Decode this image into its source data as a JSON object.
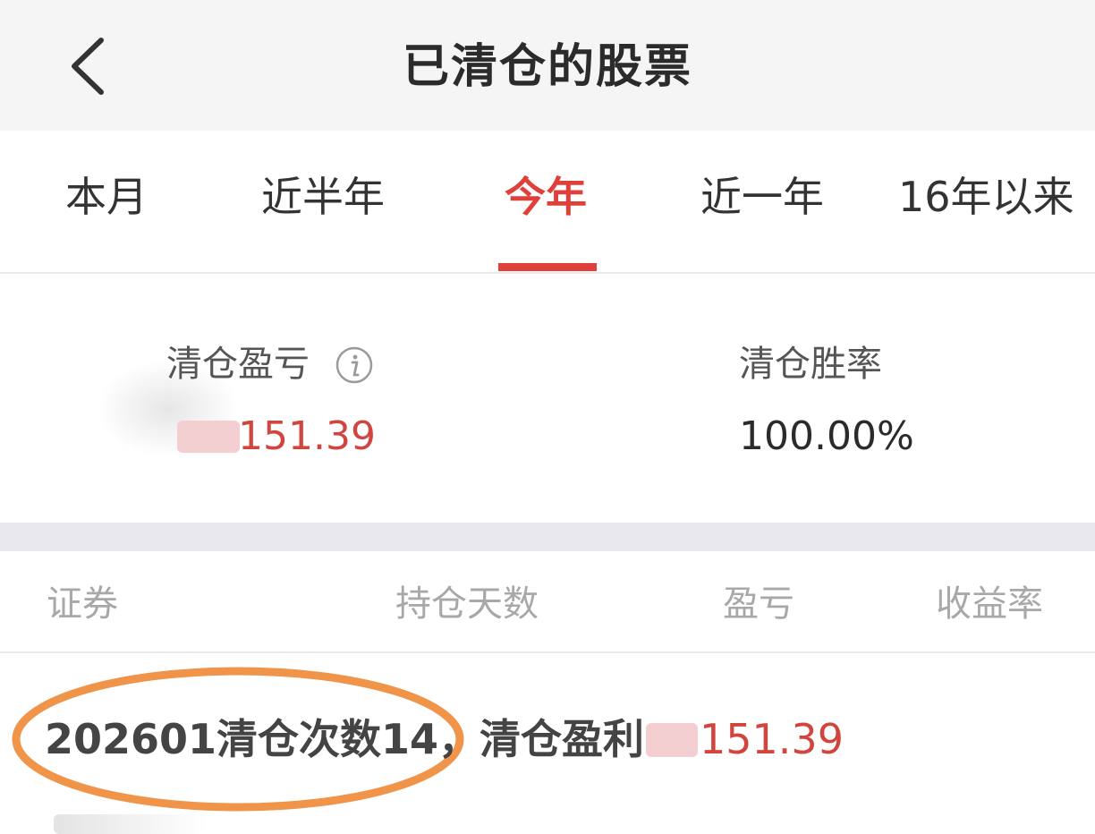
{
  "header": {
    "title": "已清仓的股票",
    "back_icon": "chevron-left-icon"
  },
  "tabs": [
    {
      "label": "本月",
      "active": false
    },
    {
      "label": "近半年",
      "active": false
    },
    {
      "label": "今年",
      "active": true
    },
    {
      "label": "近一年",
      "active": false
    },
    {
      "label": "16年以来",
      "active": false
    }
  ],
  "summary": {
    "pnl_label": "清仓盈亏",
    "pnl_value": "151.39",
    "win_rate_label": "清仓胜率",
    "win_rate_value": "100.00%",
    "info_icon": "info-icon"
  },
  "list": {
    "columns": [
      "证券",
      "持仓天数",
      "盈亏",
      "收益率"
    ]
  },
  "row": {
    "text": "202601清仓次数14，清仓盈利",
    "value": "151.39"
  },
  "colors": {
    "accent": "#e0403a",
    "profit": "#d0453e",
    "annotation": "#f0944a",
    "header_bg": "#f5f5f5",
    "band": "#e8e8ee"
  }
}
